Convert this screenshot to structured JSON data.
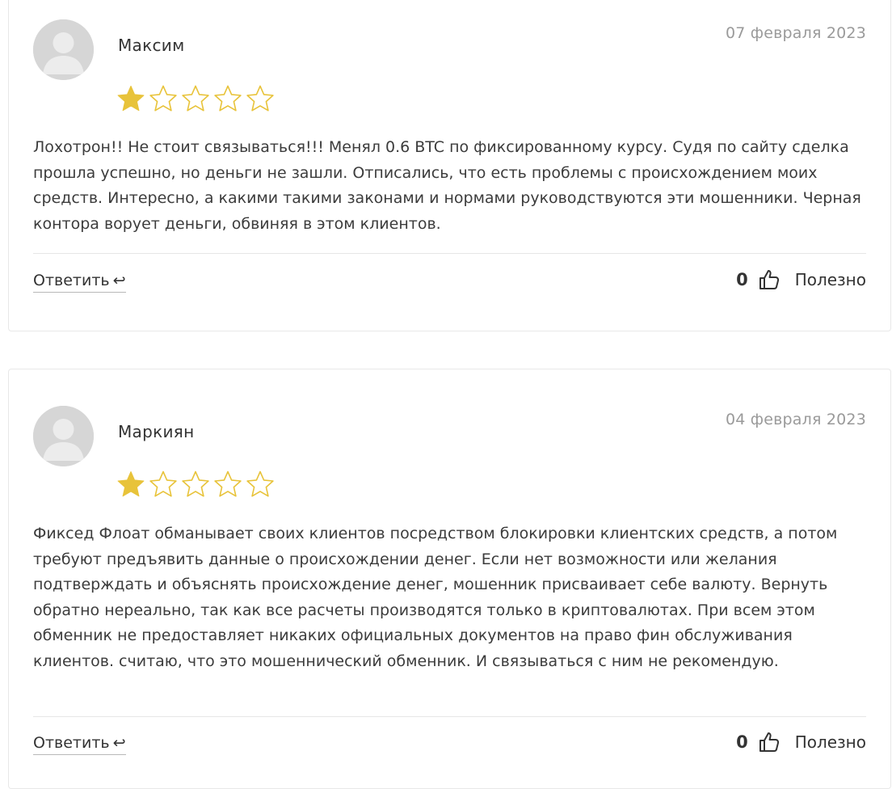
{
  "colors": {
    "star_filled": "#e8c33a",
    "star_outline": "#e8c33a",
    "date_text": "#9a9a9a",
    "border": "#e8e8e8"
  },
  "reviews": [
    {
      "author": "Максим",
      "date": "07 февраля 2023",
      "rating": 1,
      "rating_max": 5,
      "text": "Лохотрон!! Не стоит связываться!!! Менял 0.6 BTC по фиксированному курсу. Судя по сайту сделка прошла успешно, но деньги не зашли. Отписались, что есть проблемы с происхождением моих средств. Интересно, а какими такими законами и нормами руководствуются эти мошенники. Черная контора ворует деньги, обвиняя в этом клиентов.",
      "reply_label": "Ответить",
      "reply_arrow": "↩",
      "likes": "0",
      "useful_label": "Полезно"
    },
    {
      "author": "Маркиян",
      "date": "04 февраля 2023",
      "rating": 1,
      "rating_max": 5,
      "text": "Фиксед Флоат обманывает своих клиентов посредством блокировки клиентских средств, а потом требуют предъявить данные о происхождении денег. Если нет возможности или желания подтверждать и объяснять происхождение денег, мошенник присваивает себе валюту. Вернуть обратно нереально, так как все расчеты производятся только в криптовалютах. При всем этом обменник не предоставляет никаких официальных документов на право фин обслуживания клиентов. считаю, что это мошеннический обменник. И связываться с ним не рекомендую.",
      "reply_label": "Ответить",
      "reply_arrow": "↩",
      "likes": "0",
      "useful_label": "Полезно"
    }
  ]
}
